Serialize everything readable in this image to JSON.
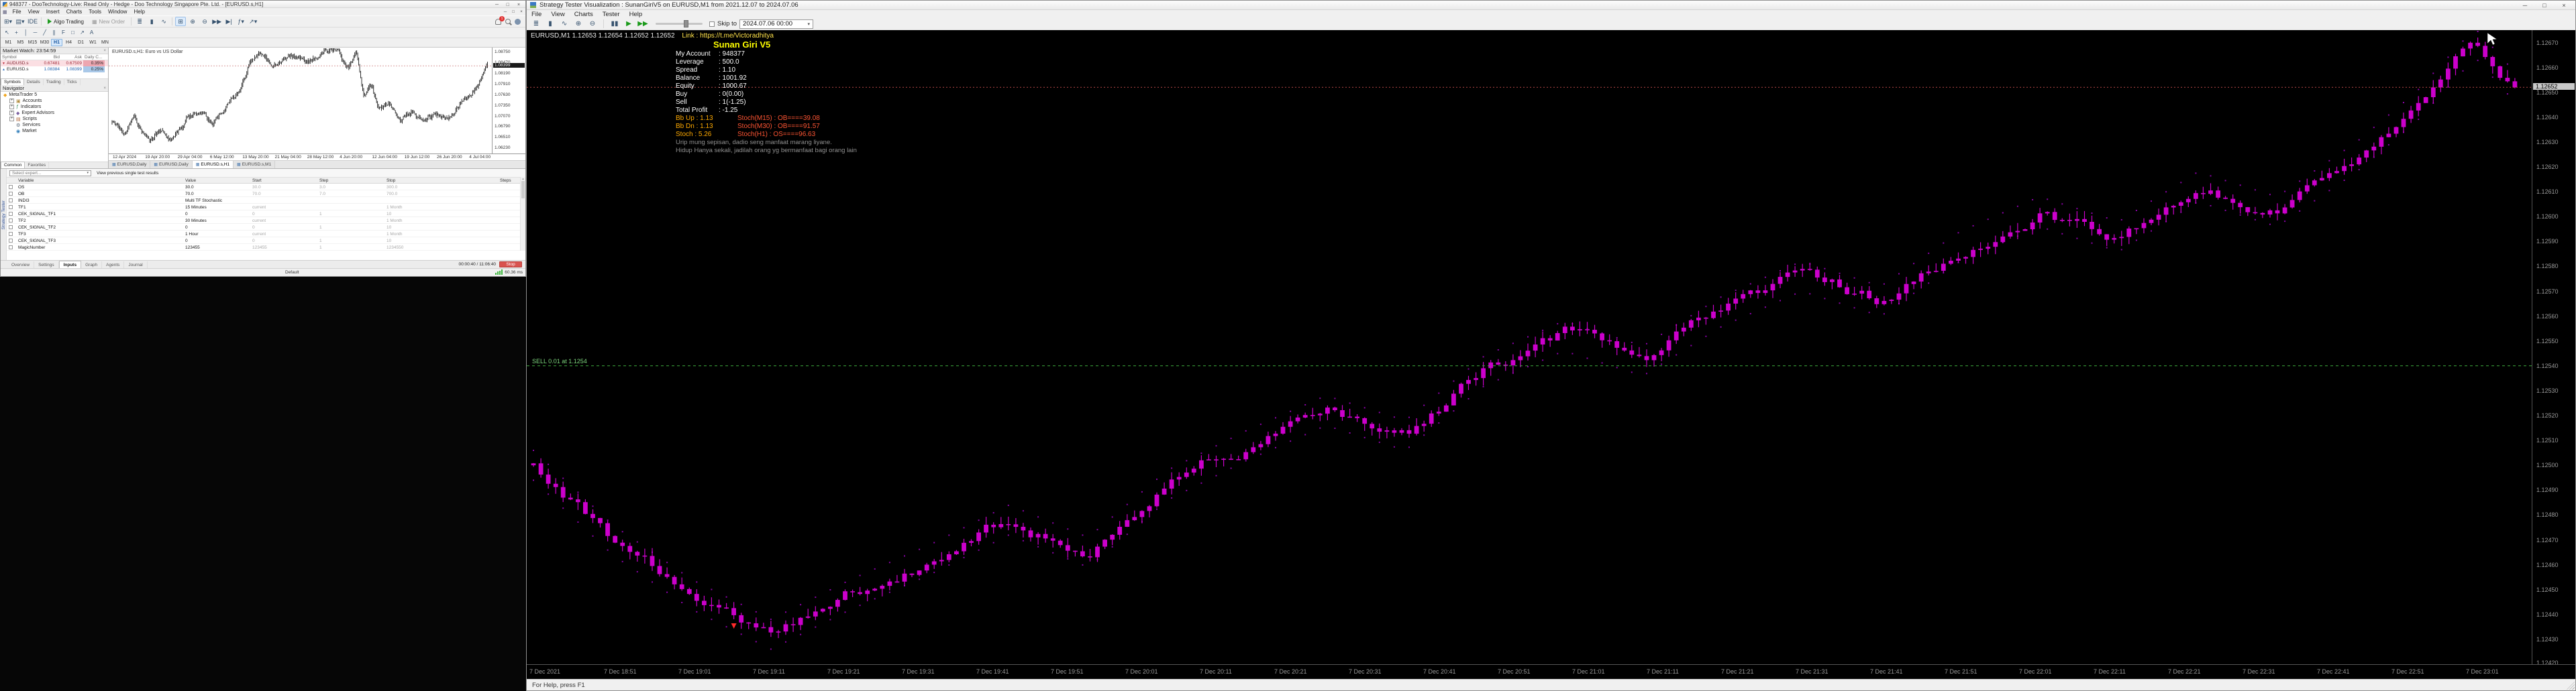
{
  "ui": {
    "caret": "▾"
  },
  "window_buttons": [
    "─",
    "□",
    "×"
  ],
  "colors": {
    "candle_left": "#161616",
    "candle_right": "#cc00cc",
    "band_right": "#8a00a8",
    "sell_line": "#3fae3f",
    "current_line": "#b84848",
    "stop_red": "#d9534f",
    "badge_red": "#e03131"
  },
  "mt5": {
    "title": "948377 - DooTechnology-Live: Read Only - Hedge - Doo Technology Singapore Pte. Ltd. - [EURUSD.s,H1]",
    "menus": [
      "File",
      "View",
      "Insert",
      "Charts",
      "Tools",
      "Window",
      "Help"
    ],
    "toolbar": {
      "icons_left": [
        {
          "name": "new-chart-icon",
          "glyph": "⊞▾"
        },
        {
          "name": "profiles-icon",
          "glyph": "▤▾"
        },
        {
          "name": "ide-button",
          "glyph": "IDE"
        }
      ],
      "algo_trading": "Algo Trading",
      "new_order": "New Order",
      "badge": "1",
      "icons_chart": [
        {
          "name": "chart-bars-icon",
          "glyph": "≣"
        },
        {
          "name": "chart-candles-icon",
          "glyph": "▮"
        },
        {
          "name": "chart-line-icon",
          "glyph": "∿"
        }
      ],
      "icons_view": [
        {
          "name": "tile-windows-icon",
          "glyph": "⊞",
          "active": true
        },
        {
          "name": "zoom-in-icon",
          "glyph": "⊕"
        },
        {
          "name": "zoom-out-icon",
          "glyph": "⊖"
        },
        {
          "name": "auto-scroll-icon",
          "glyph": "▶▶"
        },
        {
          "name": "chart-shift-icon",
          "glyph": "▶|"
        },
        {
          "name": "indicators-icon",
          "glyph": "ƒ▾"
        },
        {
          "name": "objects-icon",
          "glyph": "↗▾"
        }
      ]
    },
    "drawbar": [
      {
        "name": "cursor-icon",
        "glyph": "↖"
      },
      {
        "name": "crosshair-icon",
        "glyph": "+"
      },
      {
        "name": "vertical-line-icon",
        "glyph": "│"
      },
      {
        "name": "horizontal-line-icon",
        "glyph": "─"
      },
      {
        "name": "trendline-icon",
        "glyph": "╱"
      },
      {
        "name": "channel-icon",
        "glyph": "∥"
      },
      {
        "name": "fibonacci-icon",
        "glyph": "F"
      },
      {
        "name": "shapes-icon",
        "glyph": "□"
      },
      {
        "name": "arrows-icon",
        "glyph": "↗"
      },
      {
        "name": "text-icon",
        "glyph": "A"
      }
    ],
    "timeframes": [
      "M1",
      "M5",
      "M15",
      "M30",
      "H1",
      "H4",
      "D1",
      "W1",
      "MN"
    ],
    "active_timeframe": "H1",
    "market_watch": {
      "title": "Market Watch: 23:54:59",
      "columns": [
        "Symbol",
        "Bid",
        "Ask",
        "Daily C..."
      ],
      "rows": [
        {
          "symbol": "AUDUSD.s",
          "bid": "0.67481",
          "ask": "0.67509",
          "daily": "0.35%",
          "dir": "down"
        },
        {
          "symbol": "EURUSD.s",
          "bid": "1.08384",
          "ask": "1.08399",
          "daily": "0.25%",
          "dir": "up"
        }
      ],
      "tabs": [
        "Symbols",
        "Details",
        "Trading",
        "Ticks"
      ],
      "active_tab": "Symbols"
    },
    "navigator": {
      "title": "Navigator",
      "root": "MetaTrader 5",
      "items": [
        {
          "label": "Accounts",
          "expand": true,
          "icon": "accounts-icon",
          "glyph": "▣",
          "color": "#b08d3f"
        },
        {
          "label": "Indicators",
          "expand": true,
          "icon": "indicators-icon",
          "glyph": "ƒ",
          "color": "#2e8b57"
        },
        {
          "label": "Expert Advisors",
          "expand": true,
          "icon": "expert-advisors-icon",
          "glyph": "◆",
          "color": "#7a5fa0"
        },
        {
          "label": "Scripts",
          "expand": true,
          "icon": "scripts-icon",
          "glyph": "▤",
          "color": "#b06030"
        },
        {
          "label": "Services",
          "expand": false,
          "icon": "services-icon",
          "glyph": "⚙",
          "color": "#556677"
        },
        {
          "label": "Market",
          "expand": false,
          "icon": "market-icon",
          "glyph": "◉",
          "color": "#2a7ab8"
        }
      ],
      "tabs": [
        "Common",
        "Favorites"
      ],
      "active_tab": "Common"
    },
    "chart": {
      "symbol_label": "EURUSD.s,H1:  Euro vs US Dollar",
      "top": 1.0888,
      "bottom": 1.0609,
      "axis_labels_start": 1.0875,
      "axis_step": 0.0028,
      "axis_count": 10,
      "current_price": 1.08399,
      "current_str": "1.08399",
      "candles": 380,
      "seed": 20240704,
      "noise": 0.00095,
      "wick": 0.0007,
      "end_price": 1.08384,
      "waypoints": [
        [
          0,
          1.069
        ],
        [
          0.03,
          1.0662
        ],
        [
          0.06,
          1.0701
        ],
        [
          0.1,
          1.0648
        ],
        [
          0.13,
          1.0672
        ],
        [
          0.16,
          1.0642
        ],
        [
          0.2,
          1.0702
        ],
        [
          0.24,
          1.0722
        ],
        [
          0.27,
          1.0692
        ],
        [
          0.31,
          1.0742
        ],
        [
          0.34,
          1.0772
        ],
        [
          0.37,
          1.0858
        ],
        [
          0.4,
          1.0878
        ],
        [
          0.43,
          1.0842
        ],
        [
          0.47,
          1.0868
        ],
        [
          0.52,
          1.0852
        ],
        [
          0.57,
          1.0878
        ],
        [
          0.6,
          1.0884
        ],
        [
          0.63,
          1.0832
        ],
        [
          0.65,
          1.0878
        ],
        [
          0.67,
          1.0764
        ],
        [
          0.69,
          1.0786
        ],
        [
          0.71,
          1.0724
        ],
        [
          0.74,
          1.0742
        ],
        [
          0.77,
          1.0704
        ],
        [
          0.8,
          1.0724
        ],
        [
          0.83,
          1.0694
        ],
        [
          0.86,
          1.0714
        ],
        [
          0.89,
          1.0698
        ],
        [
          0.92,
          1.0734
        ],
        [
          0.95,
          1.0752
        ],
        [
          0.98,
          1.0796
        ],
        [
          1,
          1.0838
        ]
      ],
      "dates": [
        "12 Apr 2024",
        "19 Apr 20:00",
        "29 Apr 04:00",
        "6 May 12:00",
        "13 May 20:00",
        "21 May 04:00",
        "28 May 12:00",
        "4 Jun 20:00",
        "12 Jun 04:00",
        "19 Jun 12:00",
        "26 Jun 20:00",
        "4 Jul 04:00"
      ]
    },
    "chart_tabs": [
      "EURUSD,Daily",
      "EURUSD,Daily",
      "EURUSD.s,H1",
      "EURUSD.s,M1"
    ],
    "active_chart_tab": 2,
    "tester": {
      "vertical_label": "Strategy Tester",
      "expert_placeholder": "Select expert...",
      "link": "View previous single test results",
      "columns": [
        "Variable",
        "Value",
        "Start",
        "Step",
        "Stop",
        "Steps"
      ],
      "rows": [
        {
          "variable": "OS",
          "value": "30.0",
          "start": "30.0",
          "step": "3.0",
          "stop": "300.0"
        },
        {
          "variable": "OB",
          "value": "70.0",
          "start": "70.0",
          "step": "7.0",
          "stop": "700.0"
        },
        {
          "variable": "INDI3",
          "value": "Multi TF Stochastic",
          "start": "",
          "step": "",
          "stop": ""
        },
        {
          "variable": "TF1",
          "value": "15 Minutes",
          "start": "current",
          "step": "",
          "stop": "1 Month"
        },
        {
          "variable": "CEK_SIGNAL_TF1",
          "value": "0",
          "start": "0",
          "step": "1",
          "stop": "10"
        },
        {
          "variable": "TF2",
          "value": "30 Minutes",
          "start": "current",
          "step": "",
          "stop": "1 Month"
        },
        {
          "variable": "CEK_SIGNAL_TF2",
          "value": "0",
          "start": "0",
          "step": "1",
          "stop": "10"
        },
        {
          "variable": "TF3",
          "value": "1 Hour",
          "start": "current",
          "step": "",
          "stop": "1 Month"
        },
        {
          "variable": "CEK_SIGNAL_TF3",
          "value": "0",
          "start": "0",
          "step": "1",
          "stop": "10"
        },
        {
          "variable": "MagicNumber",
          "value": "123455",
          "start": "123455",
          "step": "1",
          "stop": "1234550"
        }
      ],
      "tabs": [
        "Overview",
        "Settings",
        "Inputs",
        "Graph",
        "Agents",
        "Journal"
      ],
      "active_tab": "Inputs",
      "time": "00:00:40 / 11:06:40",
      "stop_label": "Stop"
    },
    "status": {
      "profile": "Default",
      "ping": "60.36 ms"
    }
  },
  "viz": {
    "title": "Strategy Tester Visualization : SunanGiriV5 on EURUSD,M1 from 2021.12.07 to 2024.07.06",
    "menus": [
      "File",
      "View",
      "Charts",
      "Tester",
      "Help"
    ],
    "toolbar": {
      "icons": [
        {
          "name": "chart-bars-icon",
          "glyph": "≣"
        },
        {
          "name": "chart-candles-icon",
          "glyph": "▮"
        },
        {
          "name": "chart-line-icon",
          "glyph": "∿"
        },
        {
          "name": "zoom-in-icon",
          "glyph": "⊕"
        },
        {
          "name": "zoom-out-icon",
          "glyph": "⊖"
        }
      ],
      "playback": [
        {
          "name": "pause-icon",
          "glyph": "▮▮",
          "green": false
        },
        {
          "name": "play-icon",
          "glyph": "▶",
          "green": true
        },
        {
          "name": "fast-forward-icon",
          "glyph": "▶▶",
          "green": true
        }
      ],
      "skip_label": "Skip to",
      "date": "2024.07.06 00:00"
    },
    "ohlc": "EURUSD,M1  1.12653 1.12654 1.12652 1.12652",
    "link": "Link : https://t.me/Victoradhitya",
    "overlay": {
      "title": "Sunan Giri V5",
      "account_rows": [
        {
          "label": "My Account",
          "value": "948377"
        },
        {
          "label": "Leverage",
          "value": "500.0"
        },
        {
          "label": "Spread",
          "value": "1.10"
        },
        {
          "label": "Balance",
          "value": "1001.92"
        },
        {
          "label": "Equity",
          "value": "1000.67"
        },
        {
          "label": "Buy",
          "value": "0(0.00)"
        },
        {
          "label": "Sell",
          "value": "1(-1.25)"
        },
        {
          "label": "Total Profit",
          "value": "-1.25"
        }
      ],
      "indicator_rows": [
        {
          "left": "Bb Up : 1.13",
          "right": "Stoch(M15) : OB====39.08"
        },
        {
          "left": "Bb Dn : 1.13",
          "right": "Stoch(M30) : OB====91.57"
        },
        {
          "left": "Stoch : 5.26",
          "right": "Stoch(H1) : OS====96.63"
        }
      ],
      "quotes": [
        "Urip mung sepisan, dadio seng manfaat marang liyane.",
        "Hidup Hanya sekali, jadilah orang yg bermanfaat bagi orang lain"
      ]
    },
    "chart": {
      "top": 1.12675,
      "bottom": 1.1242,
      "axis_labels_start": 1.1267,
      "axis_step": 0.0001,
      "axis_count": 26,
      "current_price": 1.12652,
      "current_str": "1.12652",
      "sell_price": 1.1254,
      "sell_label": "SELL 0.01 at 1.1254",
      "band": 6e-05,
      "candles": 268,
      "seed": 777,
      "noise": 4.2e-05,
      "wick": 3.2e-05,
      "end_price": 1.12652,
      "waypoints": [
        [
          0,
          1.125
        ],
        [
          0.04,
          1.1247
        ],
        [
          0.08,
          1.12448
        ],
        [
          0.12,
          1.12432
        ],
        [
          0.16,
          1.12448
        ],
        [
          0.2,
          1.12462
        ],
        [
          0.24,
          1.12478
        ],
        [
          0.28,
          1.12465
        ],
        [
          0.32,
          1.12492
        ],
        [
          0.36,
          1.12508
        ],
        [
          0.4,
          1.12522
        ],
        [
          0.44,
          1.12512
        ],
        [
          0.48,
          1.12538
        ],
        [
          0.52,
          1.12552
        ],
        [
          0.56,
          1.12542
        ],
        [
          0.6,
          1.12562
        ],
        [
          0.64,
          1.12576
        ],
        [
          0.68,
          1.12566
        ],
        [
          0.72,
          1.12588
        ],
        [
          0.76,
          1.12602
        ],
        [
          0.8,
          1.12592
        ],
        [
          0.84,
          1.12612
        ],
        [
          0.88,
          1.12602
        ],
        [
          0.92,
          1.12624
        ],
        [
          0.95,
          1.12644
        ],
        [
          0.98,
          1.1267
        ],
        [
          1,
          1.12652
        ]
      ],
      "times": [
        "7 Dec 2021",
        "7 Dec 18:51",
        "7 Dec 19:01",
        "7 Dec 19:11",
        "7 Dec 19:21",
        "7 Dec 19:31",
        "7 Dec 19:41",
        "7 Dec 19:51",
        "7 Dec 20:01",
        "7 Dec 20:11",
        "7 Dec 20:21",
        "7 Dec 20:31",
        "7 Dec 20:41",
        "7 Dec 20:51",
        "7 Dec 21:01",
        "7 Dec 21:11",
        "7 Dec 21:21",
        "7 Dec 21:31",
        "7 Dec 21:41",
        "7 Dec 21:51",
        "7 Dec 22:01",
        "7 Dec 22:11",
        "7 Dec 22:21",
        "7 Dec 22:31",
        "7 Dec 22:41",
        "7 Dec 22:51",
        "7 Dec 23:01"
      ]
    },
    "status": "For Help, press F1"
  }
}
